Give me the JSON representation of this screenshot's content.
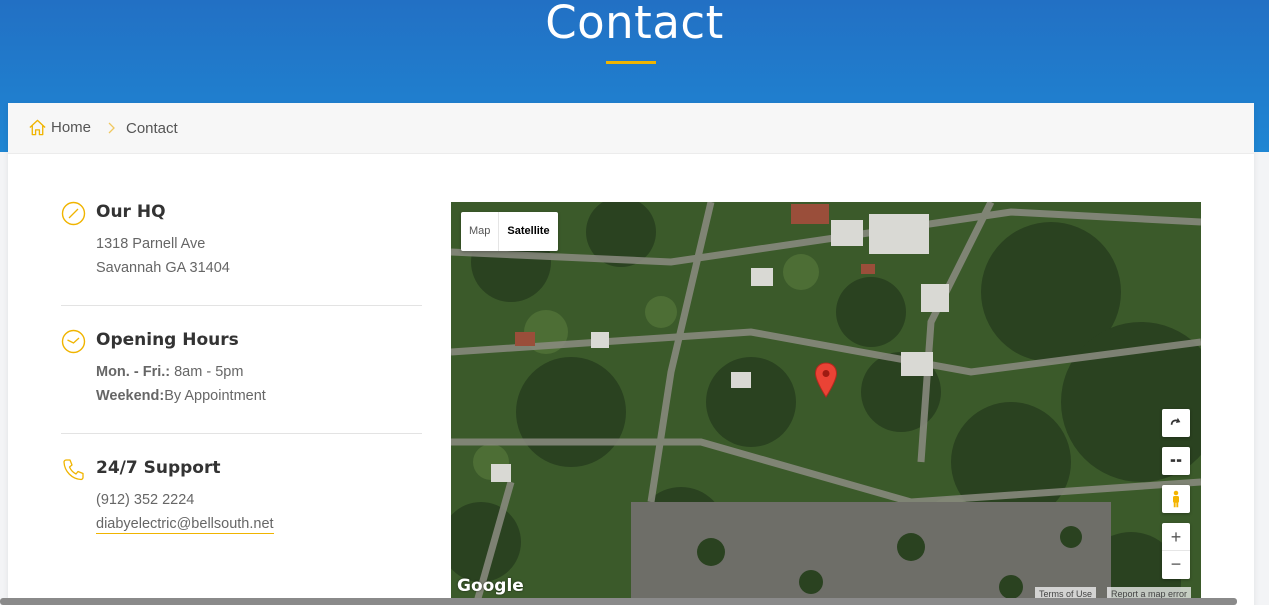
{
  "header": {
    "title": "Contact"
  },
  "breadcrumb": {
    "home": "Home",
    "current": "Contact"
  },
  "contact": {
    "hq": {
      "title": "Our HQ",
      "line1": "1318 Parnell Ave",
      "line2": "Savannah GA 31404"
    },
    "hours": {
      "title": "Opening Hours",
      "weekday_label": "Mon. - Fri.:",
      "weekday_value": " 8am - 5pm",
      "weekend_label": "Weekend:",
      "weekend_value": "By Appointment"
    },
    "support": {
      "title": "24/7 Support",
      "phone": "(912) 352 2224",
      "email": "diabyelectric@bellsouth.net"
    }
  },
  "map": {
    "type_map": "Map",
    "type_satellite": "Satellite",
    "selected_type": "Satellite",
    "zoom_in": "+",
    "zoom_out": "−",
    "brand": "Google",
    "terms": "Terms of Use",
    "report": "Report a map error",
    "icons": [
      "rotate-icon",
      "tilt-icon",
      "pegman-icon",
      "map-marker-icon"
    ]
  },
  "colors": {
    "brand_blue": "#1f7fd0",
    "accent": "#f0b400"
  }
}
